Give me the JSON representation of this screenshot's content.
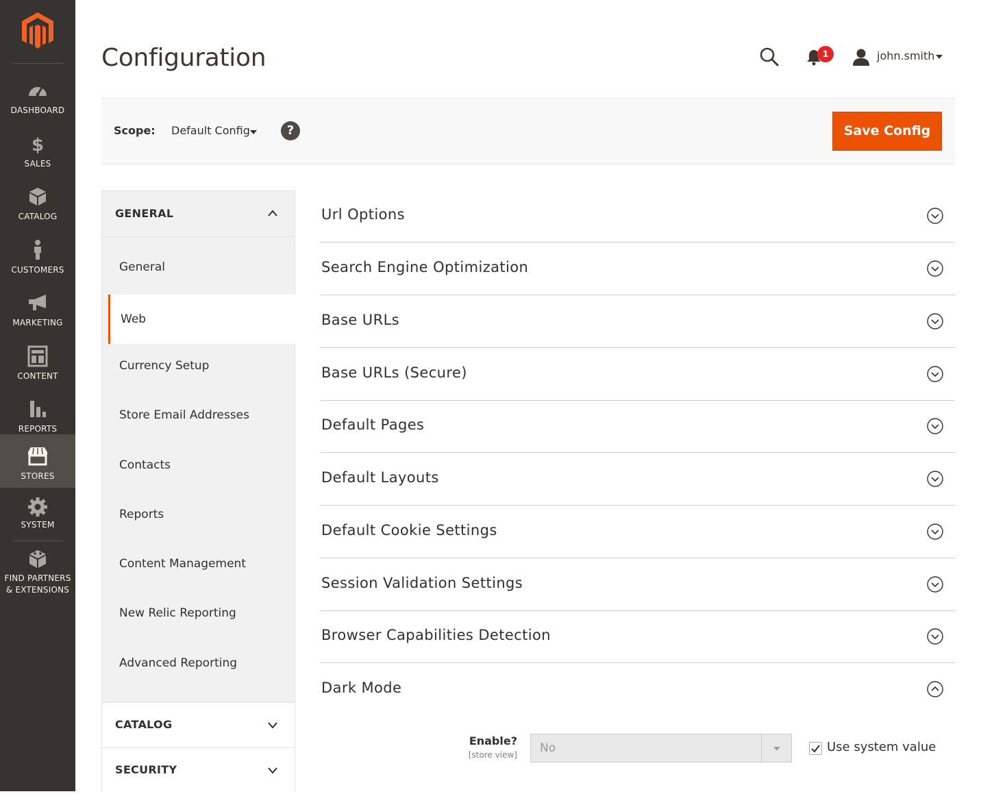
{
  "nav": {
    "items": [
      {
        "label": "DASHBOARD",
        "icon": "dashboard-icon"
      },
      {
        "label": "SALES",
        "icon": "dollar-icon"
      },
      {
        "label": "CATALOG",
        "icon": "box-icon"
      },
      {
        "label": "CUSTOMERS",
        "icon": "person-icon"
      },
      {
        "label": "MARKETING",
        "icon": "megaphone-icon"
      },
      {
        "label": "CONTENT",
        "icon": "layout-icon"
      },
      {
        "label": "REPORTS",
        "icon": "bar-chart-icon"
      },
      {
        "label": "STORES",
        "icon": "storefront-icon"
      },
      {
        "label": "SYSTEM",
        "icon": "gear-icon"
      }
    ],
    "partners_line1": "FIND PARTNERS",
    "partners_line2": "& EXTENSIONS",
    "active": "STORES"
  },
  "header": {
    "title": "Configuration",
    "notifications_count": "1",
    "username": "john.smith"
  },
  "scope": {
    "label": "Scope:",
    "value": "Default Config",
    "help": "?",
    "save_label": "Save Config"
  },
  "tabs": {
    "general_title": "GENERAL",
    "items": [
      "General",
      "Web",
      "Currency Setup",
      "Store Email Addresses",
      "Contacts",
      "Reports",
      "Content Management",
      "New Relic Reporting",
      "Advanced Reporting"
    ],
    "active_item": "Web",
    "catalog_title": "CATALOG",
    "security_title": "SECURITY"
  },
  "sections": [
    "Url Options",
    "Search Engine Optimization",
    "Base URLs",
    "Base URLs (Secure)",
    "Default Pages",
    "Default Layouts",
    "Default Cookie Settings",
    "Session Validation Settings",
    "Browser Capabilities Detection",
    "Dark Mode"
  ],
  "dark_mode": {
    "field_label": "Enable?",
    "field_scope": "[store view]",
    "value": "No",
    "use_system_label": "Use system value",
    "use_system_checked": true
  },
  "colors": {
    "accent": "#eb5202",
    "nav_bg": "#373330",
    "nav_active": "#524d49",
    "badge": "#e22626"
  }
}
